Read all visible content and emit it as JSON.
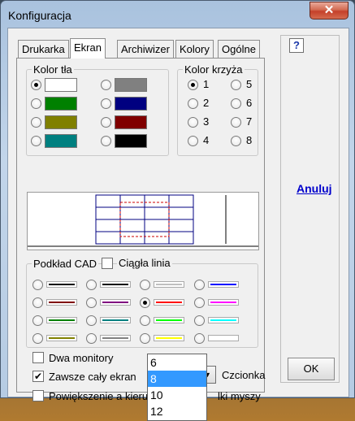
{
  "window": {
    "title": "Konfiguracja",
    "close_glyph": "✕"
  },
  "tabs": [
    {
      "label": "Drukarka"
    },
    {
      "label": "Ekran"
    },
    {
      "label": "Archiwizer"
    },
    {
      "label": "Kolory"
    },
    {
      "label": "Ogólne"
    }
  ],
  "background_color": {
    "label": "Kolor tła",
    "options": [
      {
        "color": "#ffffff",
        "checked": true
      },
      {
        "color": "#808080",
        "checked": false
      },
      {
        "color": "#008000",
        "checked": false
      },
      {
        "color": "#000080",
        "checked": false
      },
      {
        "color": "#808000",
        "checked": false
      },
      {
        "color": "#800000",
        "checked": false
      },
      {
        "color": "#008080",
        "checked": false
      },
      {
        "color": "#000000",
        "checked": false
      }
    ]
  },
  "cross_color": {
    "label": "Kolor krzyża",
    "options": [
      {
        "label": "1",
        "checked": true
      },
      {
        "label": "5",
        "checked": false
      },
      {
        "label": "2",
        "checked": false
      },
      {
        "label": "6",
        "checked": false
      },
      {
        "label": "3",
        "checked": false
      },
      {
        "label": "7",
        "checked": false
      },
      {
        "label": "4",
        "checked": false
      },
      {
        "label": "8",
        "checked": false
      }
    ]
  },
  "cad": {
    "label": "Podkład CAD",
    "continuous_line_label": "Ciągła linia",
    "lines": [
      {
        "color": "#000000",
        "checked": false
      },
      {
        "color": "#000000",
        "checked": false
      },
      {
        "color": "#c0c0c0",
        "checked": false
      },
      {
        "color": "#0000ff",
        "checked": false
      },
      {
        "color": "#800000",
        "checked": false
      },
      {
        "color": "#800080",
        "checked": false
      },
      {
        "color": "#ff0000",
        "checked": true
      },
      {
        "color": "#ff00ff",
        "checked": false
      },
      {
        "color": "#008000",
        "checked": false
      },
      {
        "color": "#008080",
        "checked": false
      },
      {
        "color": "#00ff00",
        "checked": false
      },
      {
        "color": "#00ffff",
        "checked": false
      },
      {
        "color": "#808000",
        "checked": false
      },
      {
        "color": "#808080",
        "checked": false
      },
      {
        "color": "#ffff00",
        "checked": false
      },
      {
        "color": "#ffffff",
        "checked": false
      }
    ]
  },
  "options": {
    "dual_monitors": "Dwa monitory",
    "always_fullscreen": "Zawsze cały ekran",
    "zoom_label_left": "Powiększenie a kierun",
    "zoom_label_right": "lki myszy",
    "font_label": "Czcionka"
  },
  "font_size": {
    "selected": "8",
    "options": [
      "6",
      "8",
      "10",
      "12"
    ]
  },
  "side": {
    "help": "?",
    "cancel": "Anuluj",
    "ok": "OK"
  }
}
